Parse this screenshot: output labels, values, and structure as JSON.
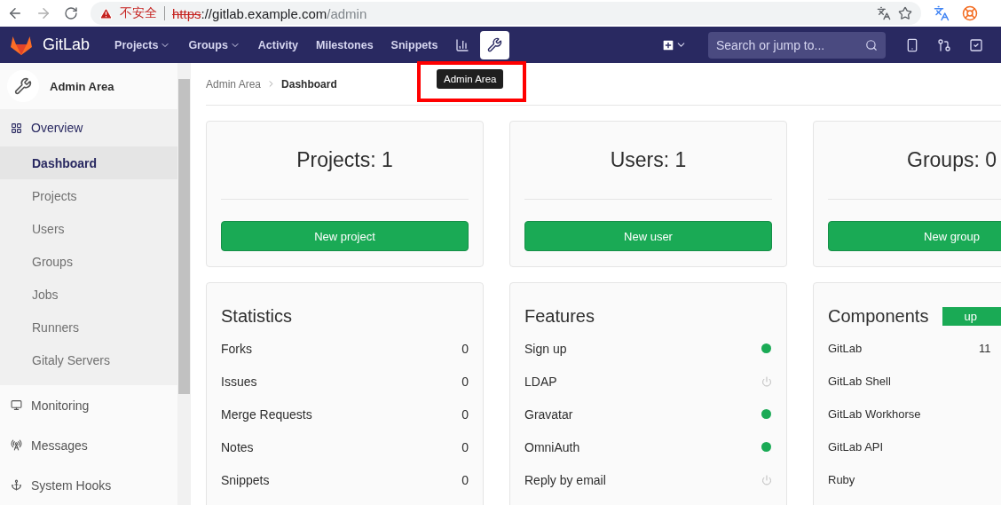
{
  "browser": {
    "warning": "不安全",
    "url_scheme": "https",
    "url_host": "://gitlab.example.com",
    "url_path": "/admin"
  },
  "navbar": {
    "brand": "GitLab",
    "items": [
      {
        "label": "Projects",
        "kind": "dropdown"
      },
      {
        "label": "Groups",
        "kind": "dropdown"
      },
      {
        "label": "Activity",
        "kind": "link"
      },
      {
        "label": "Milestones",
        "kind": "link"
      },
      {
        "label": "Snippets",
        "kind": "link"
      }
    ],
    "admin_selected": true,
    "tooltip": "Admin Area",
    "search": {
      "placeholder": "Search or jump to..."
    }
  },
  "sidebar": {
    "title": "Admin Area",
    "sections": [
      {
        "label": "Overview",
        "expanded": true,
        "children": [
          {
            "label": "Dashboard",
            "selected": true
          },
          {
            "label": "Projects",
            "selected": false
          },
          {
            "label": "Users",
            "selected": false
          },
          {
            "label": "Groups",
            "selected": false
          },
          {
            "label": "Jobs",
            "selected": false
          },
          {
            "label": "Runners",
            "selected": false
          },
          {
            "label": "Gitaly Servers",
            "selected": false
          }
        ]
      },
      {
        "label": "Monitoring",
        "expanded": false
      },
      {
        "label": "Messages",
        "expanded": false
      },
      {
        "label": "System Hooks",
        "expanded": false
      }
    ]
  },
  "breadcrumb": [
    {
      "label": "Admin Area"
    },
    {
      "label": "Dashboard"
    }
  ],
  "summary_cards": [
    {
      "title": "Projects: 1",
      "button": "New project"
    },
    {
      "title": "Users: 1",
      "button": "New user"
    },
    {
      "title": "Groups: 0",
      "button": "New group"
    }
  ],
  "statistics": {
    "title": "Statistics",
    "rows": [
      {
        "label": "Forks",
        "value": "0"
      },
      {
        "label": "Issues",
        "value": "0"
      },
      {
        "label": "Merge Requests",
        "value": "0"
      },
      {
        "label": "Notes",
        "value": "0"
      },
      {
        "label": "Snippets",
        "value": "0"
      }
    ]
  },
  "features": {
    "title": "Features",
    "rows": [
      {
        "label": "Sign up",
        "on": true
      },
      {
        "label": "LDAP",
        "on": false
      },
      {
        "label": "Gravatar",
        "on": true
      },
      {
        "label": "OmniAuth",
        "on": true
      },
      {
        "label": "Reply by email",
        "on": false
      }
    ]
  },
  "components": {
    "title": "Components",
    "badge": "up",
    "rows": [
      {
        "label": "GitLab",
        "value": "11"
      },
      {
        "label": "GitLab Shell"
      },
      {
        "label": "GitLab Workhorse"
      },
      {
        "label": "GitLab API"
      },
      {
        "label": "Ruby"
      }
    ]
  }
}
